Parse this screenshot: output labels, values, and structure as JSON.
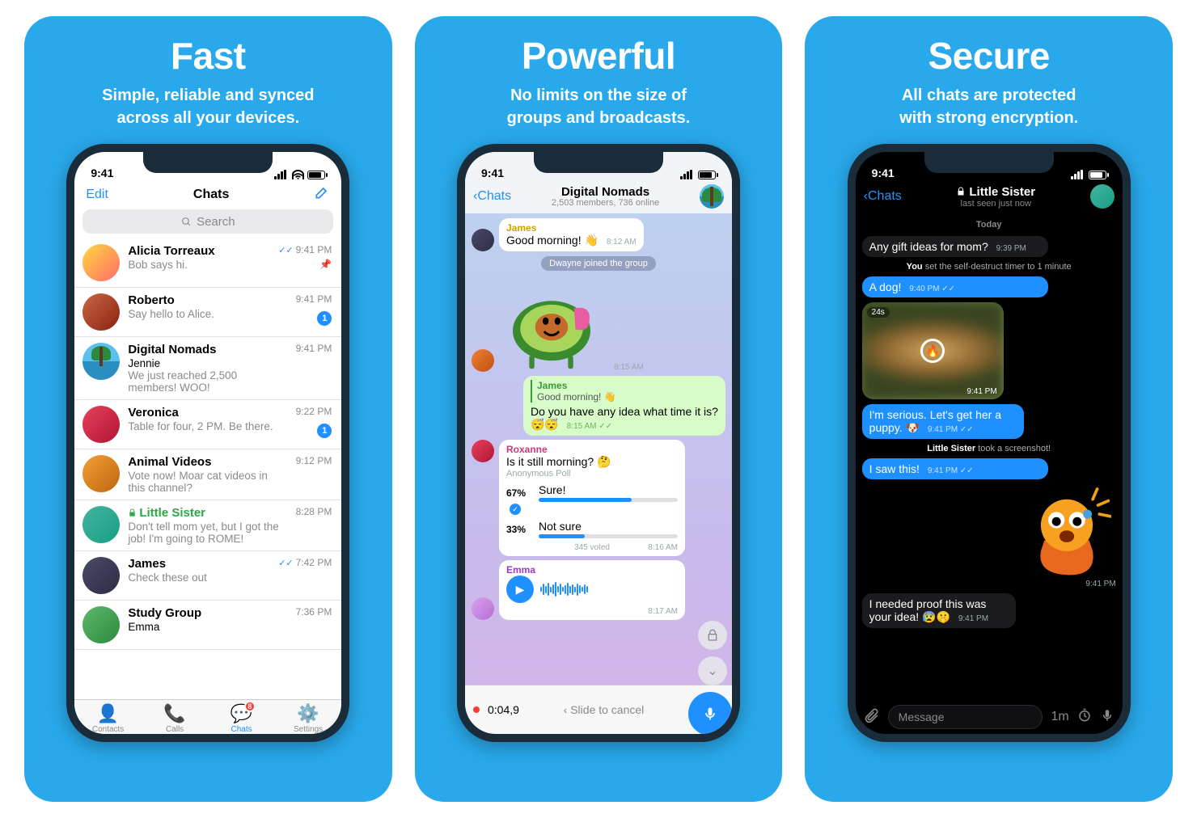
{
  "cards": [
    {
      "title": "Fast",
      "subtitle": "Simple, reliable and synced\nacross all your devices."
    },
    {
      "title": "Powerful",
      "subtitle": "No limits on the size of\ngroups and broadcasts."
    },
    {
      "title": "Secure",
      "subtitle": "All chats are protected\nwith strong encryption."
    }
  ],
  "status_time": "9:41",
  "screen1": {
    "edit": "Edit",
    "title": "Chats",
    "search_placeholder": "Search",
    "chats": [
      {
        "name": "Alicia Torreaux",
        "msg": "Bob says hi.",
        "time": "9:41 PM",
        "checks": true,
        "pinned": true
      },
      {
        "name": "Roberto",
        "msg": "Say hello to Alice.",
        "time": "9:41 PM",
        "badge": "1"
      },
      {
        "name": "Digital Nomads",
        "sender": "Jennie",
        "msg": "We just reached 2,500 members! WOO!",
        "time": "9:41 PM"
      },
      {
        "name": "Veronica",
        "msg": "Table for four, 2 PM. Be there.",
        "time": "9:22 PM",
        "badge": "1"
      },
      {
        "name": "Animal Videos",
        "msg": "Vote now! Moar cat videos in this channel?",
        "time": "9:12 PM"
      },
      {
        "name": "Little Sister",
        "secure": true,
        "msg": "Don't tell mom yet, but I got the job! I'm going to ROME!",
        "time": "8:28 PM"
      },
      {
        "name": "James",
        "msg": "Check these out",
        "time": "7:42 PM",
        "checks": true
      },
      {
        "name": "Study Group",
        "sender": "Emma",
        "msg": "",
        "time": "7:36 PM"
      }
    ],
    "tabs": [
      {
        "label": "Contacts"
      },
      {
        "label": "Calls"
      },
      {
        "label": "Chats",
        "badge": "8",
        "active": true
      },
      {
        "label": "Settings"
      }
    ]
  },
  "screen2": {
    "back": "Chats",
    "title": "Digital Nomads",
    "subtitle": "2,503 members, 736 online",
    "m1_from": "James",
    "m1": "Good morning! 👋",
    "m1_time": "8:12 AM",
    "sys1": "Dwayne joined the group",
    "sticker_time": "8:15 AM",
    "reply_from": "James",
    "reply_text": "Good morning! 👋",
    "m2": "Do you have any idea what time it is? 😴😴",
    "m2_time": "8:15 AM",
    "poll_from": "Roxanne",
    "poll_q": "Is it still morning? 🤔",
    "poll_type": "Anonymous Poll",
    "poll_opts": [
      {
        "pct": "67%",
        "label": "Sure!",
        "fill": 67,
        "voted": true
      },
      {
        "pct": "33%",
        "label": "Not sure",
        "fill": 33
      }
    ],
    "poll_voted": "345 voted",
    "poll_time": "8:16 AM",
    "audio_from": "Emma",
    "audio_time": "8:17 AM",
    "rec_time": "0:04,9",
    "slide": "Slide to cancel"
  },
  "screen3": {
    "back": "Chats",
    "title": "Little Sister",
    "subtitle": "last seen just now",
    "day": "Today",
    "m1": "Any gift ideas for mom?",
    "m1_time": "9:39 PM",
    "sys1a": "You",
    "sys1b": " set the self-destruct timer to 1 minute",
    "m2": "A dog!",
    "m2_time": "9:40 PM",
    "photo_tag": "24s",
    "photo_time": "9:41 PM",
    "m3": "I'm serious. Let's get her a puppy. 🐶",
    "m3_time": "9:41 PM",
    "sys2a": "Little Sister",
    "sys2b": " took a screenshot!",
    "m4": "I saw this!",
    "m4_time": "9:41 PM",
    "sticker_time": "9:41 PM",
    "m5": "I needed proof this was your idea! 😰🤫",
    "m5_time": "9:41 PM",
    "input_placeholder": "Message",
    "timer": "1m"
  }
}
